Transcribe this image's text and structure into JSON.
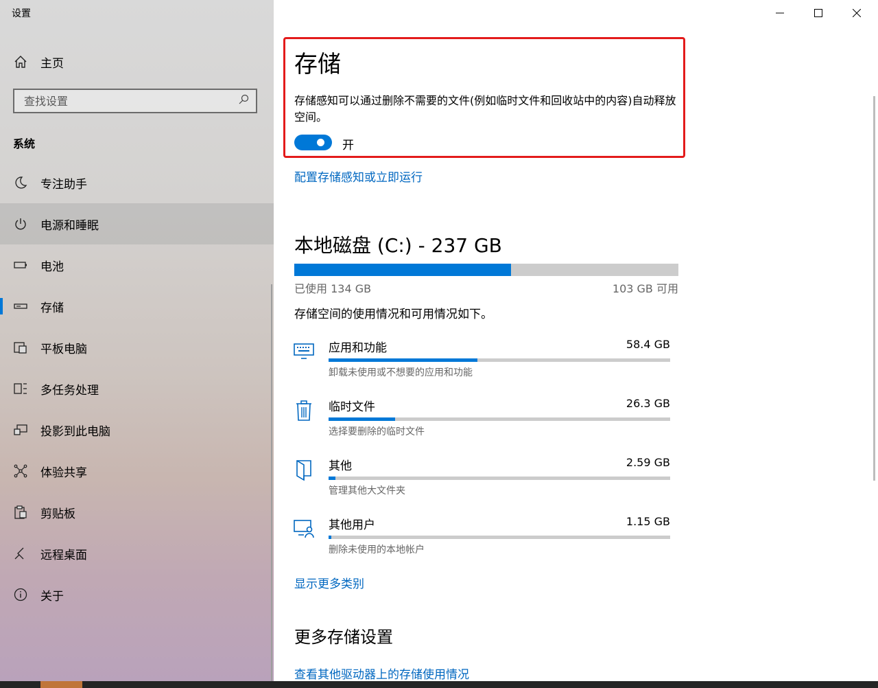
{
  "window": {
    "title": "设置"
  },
  "sidebar": {
    "home_label": "主页",
    "search_placeholder": "查找设置",
    "section_title": "系统",
    "items": [
      {
        "label": "专注助手",
        "icon": "moon-icon"
      },
      {
        "label": "电源和睡眠",
        "icon": "power-icon"
      },
      {
        "label": "电池",
        "icon": "battery-icon"
      },
      {
        "label": "存储",
        "icon": "storage-icon"
      },
      {
        "label": "平板电脑",
        "icon": "tablet-icon"
      },
      {
        "label": "多任务处理",
        "icon": "multitask-icon"
      },
      {
        "label": "投影到此电脑",
        "icon": "project-icon"
      },
      {
        "label": "体验共享",
        "icon": "share-icon"
      },
      {
        "label": "剪贴板",
        "icon": "clipboard-icon"
      },
      {
        "label": "远程桌面",
        "icon": "remote-desktop-icon"
      },
      {
        "label": "关于",
        "icon": "info-icon"
      }
    ]
  },
  "main": {
    "title": "存储",
    "storage_sense_desc": "存储感知可以通过删除不需要的文件(例如临时文件和回收站中的内容)自动释放空间。",
    "toggle_state": "开",
    "configure_link": "配置存储感知或立即运行",
    "disk_title": "本地磁盘 (C:) - 237 GB",
    "used_label": "已使用 134 GB",
    "free_label": "103 GB 可用",
    "used_fraction": 0.565,
    "usage_desc": "存储空间的使用情况和可用情况如下。",
    "categories": [
      {
        "name": "应用和功能",
        "size": "58.4 GB",
        "sub": "卸载未使用或不想要的应用和功能",
        "fraction": 0.435,
        "icon": "keyboard-icon"
      },
      {
        "name": "临时文件",
        "size": "26.3 GB",
        "sub": "选择要删除的临时文件",
        "fraction": 0.195,
        "icon": "trash-icon"
      },
      {
        "name": "其他",
        "size": "2.59 GB",
        "sub": "管理其他大文件夹",
        "fraction": 0.02,
        "icon": "folder-icon"
      },
      {
        "name": "其他用户",
        "size": "1.15 GB",
        "sub": "删除未使用的本地帐户",
        "fraction": 0.008,
        "icon": "user-screen-icon"
      }
    ],
    "more_categories_link": "显示更多类别",
    "more_settings_title": "更多存储设置",
    "other_drives_link": "查看其他驱动器上的存储使用情况"
  },
  "colors": {
    "accent": "#0078d7",
    "highlight_border": "#e31b1b"
  }
}
